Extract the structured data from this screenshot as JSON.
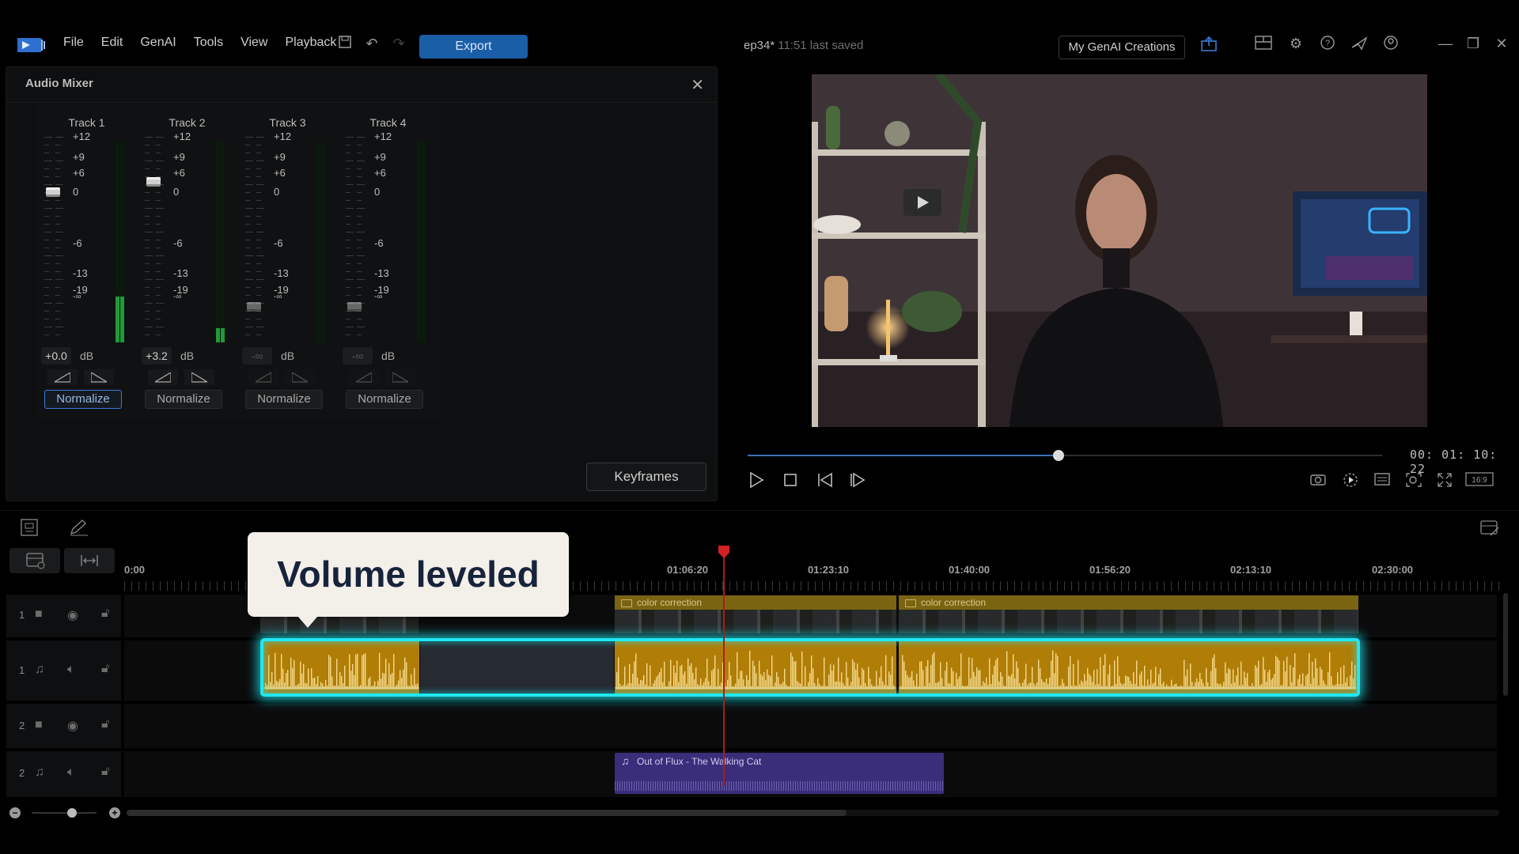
{
  "menu": [
    "File",
    "Edit",
    "GenAI",
    "Tools",
    "View",
    "Playback"
  ],
  "export_label": "Export",
  "project": {
    "name": "ep34*",
    "saved": "11:51 last saved"
  },
  "genai_label": "My GenAI Creations",
  "mixer": {
    "title": "Audio Mixer",
    "db_unit": "dB",
    "scale_labels": [
      "+12",
      "+9",
      "+6",
      "0",
      "-6",
      "-13",
      "-19",
      "-∞"
    ],
    "normalize_label": "Normalize",
    "keyframes_label": "Keyframes",
    "tracks": [
      {
        "name": "Track 1",
        "value": "+0.0",
        "meter_level": 0.23
      },
      {
        "name": "Track 2",
        "value": "+3.2",
        "meter_level": 0.07
      },
      {
        "name": "Track 3",
        "value": "-∞",
        "meter_level": 0
      },
      {
        "name": "Track 4",
        "value": "-∞",
        "meter_level": 0
      }
    ]
  },
  "player": {
    "timecode": "00: 01: 10: 22",
    "progress": 0.49,
    "aspect": "16:9"
  },
  "timeline": {
    "ruler_labels": [
      "0:00",
      "01:06:20",
      "01:23:10",
      "01:40:00",
      "01:56:20",
      "02:13:10",
      "02:30:00"
    ],
    "video_clip_label": "color correction",
    "music_clip_label": "Out of Flux - The Walking Cat",
    "tracks": [
      {
        "num": "1",
        "kind": "video"
      },
      {
        "num": "1",
        "kind": "audio"
      },
      {
        "num": "2",
        "kind": "video"
      },
      {
        "num": "2",
        "kind": "audio"
      }
    ]
  },
  "callout": "Volume leveled"
}
